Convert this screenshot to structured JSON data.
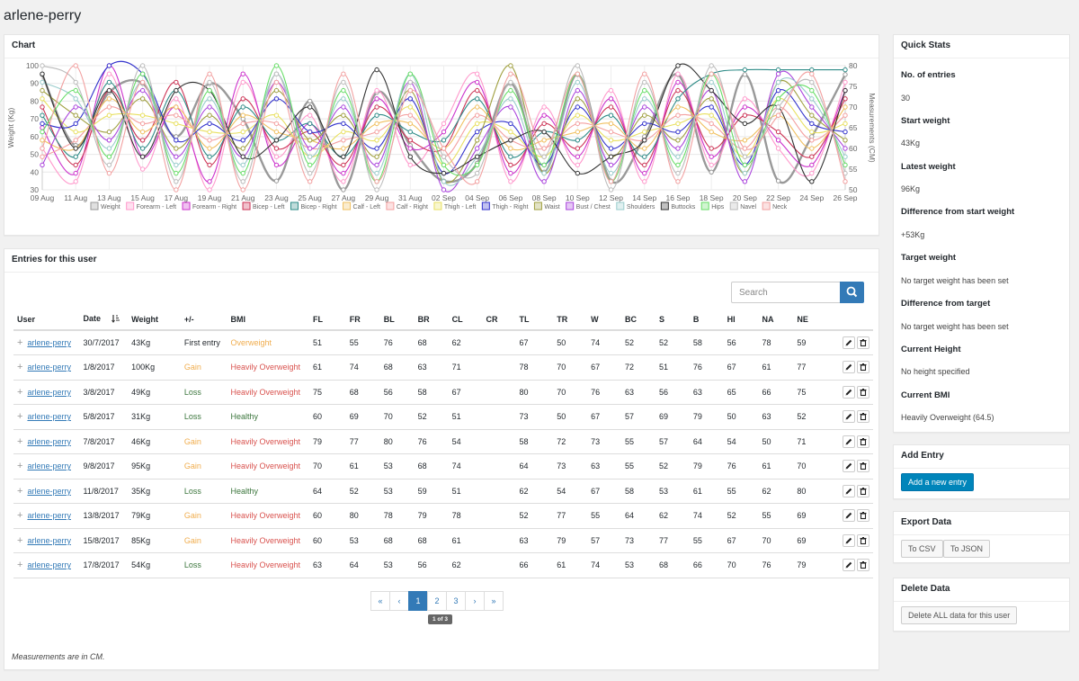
{
  "page": {
    "title": "arlene-perry"
  },
  "chart_panel": {
    "heading": "Chart"
  },
  "chart_data": {
    "type": "line",
    "title": "",
    "ylabel": "Weight (Kg)",
    "y2label": "Measurements (CM)",
    "ylim": [
      30,
      100
    ],
    "y2lim": [
      50,
      80
    ],
    "yticks": [
      30,
      40,
      50,
      60,
      70,
      80,
      90,
      100
    ],
    "y2ticks": [
      50,
      55,
      60,
      65,
      70,
      75,
      80
    ],
    "x": [
      "09 Aug",
      "11 Aug",
      "13 Aug",
      "15 Aug",
      "17 Aug",
      "19 Aug",
      "21 Aug",
      "23 Aug",
      "25 Aug",
      "27 Aug",
      "29 Aug",
      "31 Aug",
      "02 Sep",
      "04 Sep",
      "06 Sep",
      "08 Sep",
      "10 Sep",
      "12 Sep",
      "14 Sep",
      "16 Sep",
      "18 Sep",
      "20 Sep",
      "22 Sep",
      "24 Sep",
      "26 Sep"
    ],
    "grid": true,
    "legend_position": "bottom",
    "series": [
      {
        "name": "Weight",
        "color": "#999999",
        "axis": "y",
        "values": [
          95,
          55,
          85,
          90,
          60,
          90,
          70,
          35,
          80,
          30,
          85,
          55,
          35,
          45,
          90,
          40,
          95,
          35,
          60,
          95,
          40,
          95,
          35,
          60,
          95
        ]
      },
      {
        "name": "Forearm - Left",
        "color": "#ff99cc",
        "axis": "y2",
        "values": [
          60,
          52,
          78,
          55,
          72,
          50,
          76,
          58,
          68,
          52,
          74,
          56,
          66,
          78,
          52,
          70,
          56,
          74,
          52,
          78,
          56,
          72,
          60,
          54,
          76
        ]
      },
      {
        "name": "Forearm - Right",
        "color": "#cc33cc",
        "axis": "y2",
        "values": [
          65,
          54,
          80,
          58,
          70,
          52,
          78,
          56,
          66,
          54,
          72,
          60,
          64,
          76,
          54,
          68,
          58,
          72,
          54,
          76,
          58,
          70,
          62,
          56,
          74
        ]
      },
      {
        "name": "Bicep - Left",
        "color": "#cc3355",
        "axis": "y2",
        "values": [
          70,
          56,
          74,
          62,
          76,
          56,
          72,
          60,
          64,
          56,
          70,
          62,
          60,
          74,
          56,
          66,
          60,
          70,
          56,
          74,
          60,
          68,
          64,
          58,
          72
        ]
      },
      {
        "name": "Bicep - Right",
        "color": "#2e8b87",
        "axis": "y2",
        "values": [
          68,
          58,
          76,
          60,
          74,
          58,
          70,
          62,
          66,
          58,
          68,
          64,
          62,
          72,
          58,
          64,
          62,
          68,
          58,
          72,
          78,
          79,
          79,
          79,
          79
        ]
      },
      {
        "name": "Calf - Left",
        "color": "#f0c060",
        "axis": "y2",
        "values": [
          62,
          60,
          72,
          64,
          70,
          60,
          68,
          64,
          62,
          60,
          66,
          66,
          60,
          70,
          60,
          62,
          64,
          66,
          60,
          70,
          64,
          62,
          68,
          60,
          70
        ]
      },
      {
        "name": "Calf - Right",
        "color": "#f4a0a0",
        "axis": "y2",
        "values": [
          58,
          62,
          70,
          66,
          68,
          62,
          66,
          66,
          60,
          62,
          64,
          68,
          58,
          68,
          62,
          60,
          66,
          64,
          62,
          68,
          66,
          60,
          70,
          62,
          68
        ]
      },
      {
        "name": "Thigh - Left",
        "color": "#e8e060",
        "axis": "y2",
        "values": [
          72,
          64,
          68,
          68,
          66,
          64,
          64,
          68,
          58,
          64,
          62,
          70,
          56,
          66,
          64,
          58,
          68,
          62,
          64,
          66,
          68,
          58,
          72,
          64,
          66
        ]
      },
      {
        "name": "Thigh - Right",
        "color": "#3333cc",
        "axis": "y2",
        "values": [
          66,
          66,
          80,
          78,
          62,
          66,
          62,
          72,
          64,
          66,
          60,
          72,
          54,
          64,
          66,
          56,
          70,
          60,
          66,
          64,
          70,
          56,
          74,
          66,
          64
        ]
      },
      {
        "name": "Waist",
        "color": "#a0a040",
        "axis": "y2",
        "values": [
          74,
          68,
          64,
          72,
          60,
          68,
          60,
          74,
          62,
          68,
          58,
          74,
          52,
          62,
          80,
          54,
          72,
          58,
          68,
          62,
          72,
          54,
          76,
          68,
          62
        ]
      },
      {
        "name": "Bust / Chest",
        "color": "#aa44dd",
        "axis": "y2",
        "values": [
          56,
          70,
          62,
          74,
          58,
          70,
          58,
          76,
          60,
          70,
          56,
          76,
          50,
          60,
          70,
          52,
          74,
          56,
          70,
          60,
          74,
          52,
          78,
          70,
          60
        ]
      },
      {
        "name": "Shoulders",
        "color": "#99cccc",
        "axis": "y2",
        "values": [
          76,
          72,
          60,
          76,
          56,
          72,
          56,
          78,
          58,
          72,
          54,
          78,
          52,
          58,
          72,
          54,
          76,
          54,
          72,
          58,
          76,
          54,
          76,
          72,
          58
        ]
      },
      {
        "name": "Buttocks",
        "color": "#333333",
        "axis": "y2",
        "values": [
          78,
          60,
          74,
          58,
          74,
          74,
          58,
          62,
          70,
          58,
          79,
          58,
          54,
          58,
          62,
          64,
          54,
          58,
          62,
          80,
          74,
          66,
          70,
          52,
          74
        ]
      },
      {
        "name": "Hips",
        "color": "#66dd66",
        "axis": "y2",
        "values": [
          64,
          74,
          58,
          78,
          54,
          74,
          54,
          80,
          56,
          74,
          52,
          78,
          56,
          56,
          74,
          56,
          78,
          52,
          74,
          56,
          78,
          56,
          72,
          74,
          56
        ]
      },
      {
        "name": "Navel",
        "color": "#bbbbbb",
        "axis": "y2",
        "values": [
          80,
          76,
          56,
          80,
          52,
          76,
          52,
          78,
          54,
          76,
          50,
          76,
          58,
          54,
          76,
          58,
          80,
          50,
          76,
          54,
          80,
          58,
          70,
          76,
          54
        ]
      },
      {
        "name": "Neck",
        "color": "#f2a0a0",
        "axis": "y2",
        "values": [
          60,
          80,
          54,
          76,
          50,
          78,
          50,
          76,
          52,
          78,
          52,
          74,
          60,
          52,
          78,
          60,
          78,
          52,
          78,
          52,
          78,
          60,
          68,
          78,
          52
        ]
      }
    ]
  },
  "entries_panel": {
    "heading": "Entries for this user",
    "search_placeholder": "Search",
    "columns": [
      "User",
      "Date",
      "Weight",
      "+/-",
      "BMI",
      "FL",
      "FR",
      "BL",
      "BR",
      "CL",
      "CR",
      "TL",
      "TR",
      "W",
      "BC",
      "S",
      "B",
      "HI",
      "NA",
      "NE"
    ],
    "rows": [
      {
        "user": "arlene-perry",
        "date": "30/7/2017",
        "weight": "43Kg",
        "change": "First entry",
        "change_type": "first",
        "bmi": "Overweight",
        "bmi_type": "over",
        "fl": "51",
        "fr": "55",
        "bl": "76",
        "br": "68",
        "cl": "62",
        "cr": "",
        "tl": "67",
        "tr": "50",
        "w": "74",
        "bc": "52",
        "s": "52",
        "b": "58",
        "hi": "56",
        "na": "78",
        "ne": "59"
      },
      {
        "user": "arlene-perry",
        "date": "1/8/2017",
        "weight": "100Kg",
        "change": "Gain",
        "change_type": "gain",
        "bmi": "Heavily Overweight",
        "bmi_type": "over-heavy",
        "fl": "61",
        "fr": "74",
        "bl": "68",
        "br": "63",
        "cl": "71",
        "cr": "",
        "tl": "78",
        "tr": "70",
        "w": "67",
        "bc": "72",
        "s": "51",
        "b": "76",
        "hi": "67",
        "na": "61",
        "ne": "77"
      },
      {
        "user": "arlene-perry",
        "date": "3/8/2017",
        "weight": "49Kg",
        "change": "Loss",
        "change_type": "loss",
        "bmi": "Heavily Overweight",
        "bmi_type": "over-heavy",
        "fl": "75",
        "fr": "68",
        "bl": "56",
        "br": "58",
        "cl": "67",
        "cr": "",
        "tl": "80",
        "tr": "70",
        "w": "76",
        "bc": "63",
        "s": "56",
        "b": "63",
        "hi": "65",
        "na": "66",
        "ne": "75"
      },
      {
        "user": "arlene-perry",
        "date": "5/8/2017",
        "weight": "31Kg",
        "change": "Loss",
        "change_type": "loss",
        "bmi": "Healthy",
        "bmi_type": "healthy",
        "fl": "60",
        "fr": "69",
        "bl": "70",
        "br": "52",
        "cl": "51",
        "cr": "",
        "tl": "73",
        "tr": "50",
        "w": "67",
        "bc": "57",
        "s": "69",
        "b": "79",
        "hi": "50",
        "na": "63",
        "ne": "52"
      },
      {
        "user": "arlene-perry",
        "date": "7/8/2017",
        "weight": "46Kg",
        "change": "Gain",
        "change_type": "gain",
        "bmi": "Heavily Overweight",
        "bmi_type": "over-heavy",
        "fl": "79",
        "fr": "77",
        "bl": "80",
        "br": "76",
        "cl": "54",
        "cr": "",
        "tl": "58",
        "tr": "72",
        "w": "73",
        "bc": "55",
        "s": "57",
        "b": "64",
        "hi": "54",
        "na": "50",
        "ne": "71"
      },
      {
        "user": "arlene-perry",
        "date": "9/8/2017",
        "weight": "95Kg",
        "change": "Gain",
        "change_type": "gain",
        "bmi": "Heavily Overweight",
        "bmi_type": "over-heavy",
        "fl": "70",
        "fr": "61",
        "bl": "53",
        "br": "68",
        "cl": "74",
        "cr": "",
        "tl": "64",
        "tr": "73",
        "w": "63",
        "bc": "55",
        "s": "52",
        "b": "79",
        "hi": "76",
        "na": "61",
        "ne": "70"
      },
      {
        "user": "arlene-perry",
        "date": "11/8/2017",
        "weight": "35Kg",
        "change": "Loss",
        "change_type": "loss",
        "bmi": "Healthy",
        "bmi_type": "healthy",
        "fl": "64",
        "fr": "52",
        "bl": "53",
        "br": "59",
        "cl": "51",
        "cr": "",
        "tl": "62",
        "tr": "54",
        "w": "67",
        "bc": "58",
        "s": "53",
        "b": "61",
        "hi": "55",
        "na": "62",
        "ne": "80"
      },
      {
        "user": "arlene-perry",
        "date": "13/8/2017",
        "weight": "79Kg",
        "change": "Gain",
        "change_type": "gain",
        "bmi": "Heavily Overweight",
        "bmi_type": "over-heavy",
        "fl": "60",
        "fr": "80",
        "bl": "78",
        "br": "79",
        "cl": "78",
        "cr": "",
        "tl": "52",
        "tr": "77",
        "w": "55",
        "bc": "64",
        "s": "62",
        "b": "74",
        "hi": "52",
        "na": "55",
        "ne": "69"
      },
      {
        "user": "arlene-perry",
        "date": "15/8/2017",
        "weight": "85Kg",
        "change": "Gain",
        "change_type": "gain",
        "bmi": "Heavily Overweight",
        "bmi_type": "over-heavy",
        "fl": "60",
        "fr": "53",
        "bl": "68",
        "br": "68",
        "cl": "61",
        "cr": "",
        "tl": "63",
        "tr": "79",
        "w": "57",
        "bc": "73",
        "s": "77",
        "b": "55",
        "hi": "67",
        "na": "70",
        "ne": "69"
      },
      {
        "user": "arlene-perry",
        "date": "17/8/2017",
        "weight": "54Kg",
        "change": "Loss",
        "change_type": "loss",
        "bmi": "Heavily Overweight",
        "bmi_type": "over-heavy",
        "fl": "63",
        "fr": "64",
        "bl": "53",
        "br": "56",
        "cl": "62",
        "cr": "",
        "tl": "66",
        "tr": "61",
        "w": "74",
        "bc": "53",
        "s": "68",
        "b": "66",
        "hi": "70",
        "na": "76",
        "ne": "79"
      }
    ],
    "pagination": {
      "first": "«",
      "prev": "‹",
      "pages": [
        "1",
        "2",
        "3"
      ],
      "current": "1",
      "next": "›",
      "last": "»",
      "info": "1 of 3"
    },
    "note": "Measurements are in CM."
  },
  "quick_stats": {
    "heading": "Quick Stats",
    "items": [
      {
        "label": "No. of entries",
        "value": "30"
      },
      {
        "label": "Start weight",
        "value": "43Kg"
      },
      {
        "label": "Latest weight",
        "value": "96Kg"
      },
      {
        "label": "Difference from start weight",
        "value": "+53Kg"
      },
      {
        "label": "Target weight",
        "value": "No target weight has been set"
      },
      {
        "label": "Difference from target",
        "value": "No target weight has been set"
      },
      {
        "label": "Current Height",
        "value": "No height specified"
      },
      {
        "label": "Current BMI",
        "value": "Heavily Overweight (64.5)"
      }
    ]
  },
  "add_entry": {
    "heading": "Add Entry",
    "button": "Add a new entry"
  },
  "export_data": {
    "heading": "Export Data",
    "csv_button": "To CSV",
    "json_button": "To JSON"
  },
  "delete_data": {
    "heading": "Delete Data",
    "button": "Delete ALL data for this user"
  },
  "colors": {
    "primary": "#337ab7",
    "wp_blue": "#0085ba",
    "gain": "#f0ad4e",
    "loss": "#3c763d",
    "danger": "#d9534f"
  }
}
